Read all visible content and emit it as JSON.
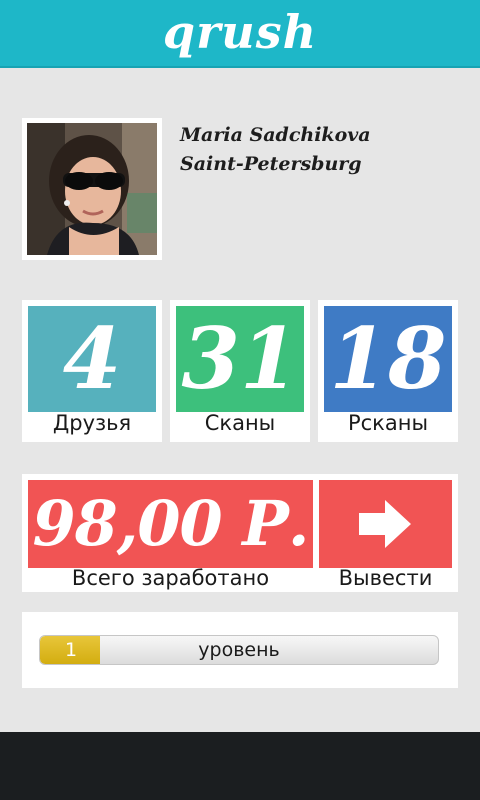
{
  "app": {
    "title": "qrush"
  },
  "profile": {
    "name": "Maria Sadchikova",
    "city": "Saint-Petersburg"
  },
  "stats": [
    {
      "value": "4",
      "label": "Друзья",
      "color": "#56b1bd"
    },
    {
      "value": "31",
      "label": "Сканы",
      "color": "#3dc07c"
    },
    {
      "value": "18",
      "label": "Рсканы",
      "color": "#3f7bc5"
    }
  ],
  "earnings": {
    "amount": "98,00 Р.",
    "label": "Всего заработано",
    "withdraw_label": "Вывести",
    "withdraw_icon": "arrow-right-icon",
    "color": "#f15454"
  },
  "level": {
    "number": "1",
    "label": "уровень",
    "progress": 0.15
  }
}
